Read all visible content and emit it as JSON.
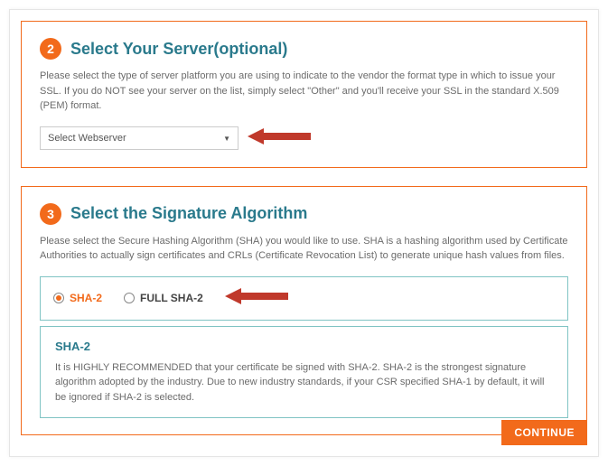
{
  "step2": {
    "number": "2",
    "title": "Select Your Server(optional)",
    "desc": "Please select the type of server platform you are using to indicate to the vendor the format type in which to issue your SSL. If you do NOT see your server on the list, simply select \"Other\" and you'll receive your SSL in the standard X.509 (PEM) format.",
    "select_placeholder": "Select Webserver"
  },
  "step3": {
    "number": "3",
    "title": "Select the Signature Algorithm",
    "desc": "Please select the Secure Hashing Algorithm (SHA) you would like to use. SHA is a hashing algorithm used by Certificate Authorities to actually sign certificates and CRLs (Certificate Revocation List) to generate unique hash values from files.",
    "options": {
      "sha2": "SHA-2",
      "full_sha2": "FULL SHA-2"
    },
    "info": {
      "heading": "SHA-2",
      "body": "It is HIGHLY RECOMMENDED that your certificate be signed with SHA-2. SHA-2 is the strongest signature algorithm adopted by the industry. Due to new industry standards, if your CSR specified SHA-1 by default, it will be ignored if SHA-2 is selected."
    }
  },
  "continue_label": "CONTINUE",
  "colors": {
    "accent": "#F26A1B",
    "teal": "#2A7A8C",
    "tealBorder": "#80C4C4",
    "arrow": "#C0392B"
  }
}
